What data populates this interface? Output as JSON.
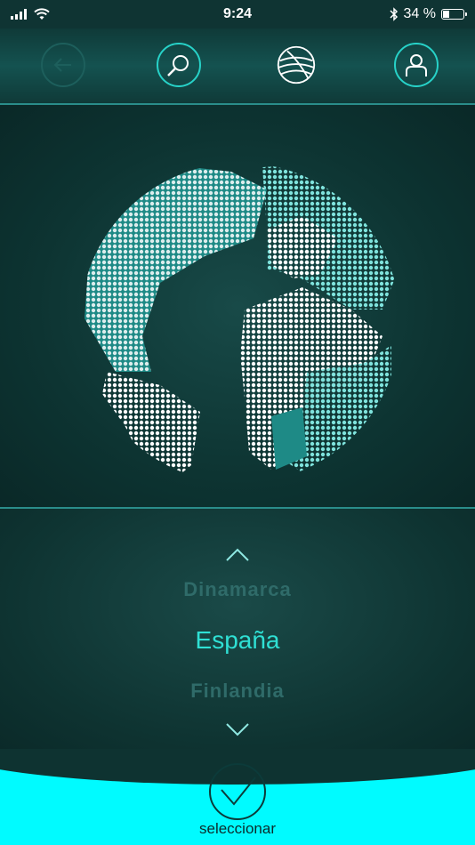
{
  "status_bar": {
    "time": "9:24",
    "battery_text": "34 %",
    "battery_level": 0.34
  },
  "nav": {
    "back_icon": "back-arrow-icon",
    "search_icon": "search-icon",
    "globe_icon": "globe-icon",
    "profile_icon": "user-icon"
  },
  "picker": {
    "prev": "Dinamarca",
    "selected": "España",
    "next": "Finlandia"
  },
  "footer": {
    "select_label": "seleccionar"
  },
  "colors": {
    "accent": "#2fe0d4",
    "footer": "#00fbff",
    "background": "#0c2b2b"
  }
}
